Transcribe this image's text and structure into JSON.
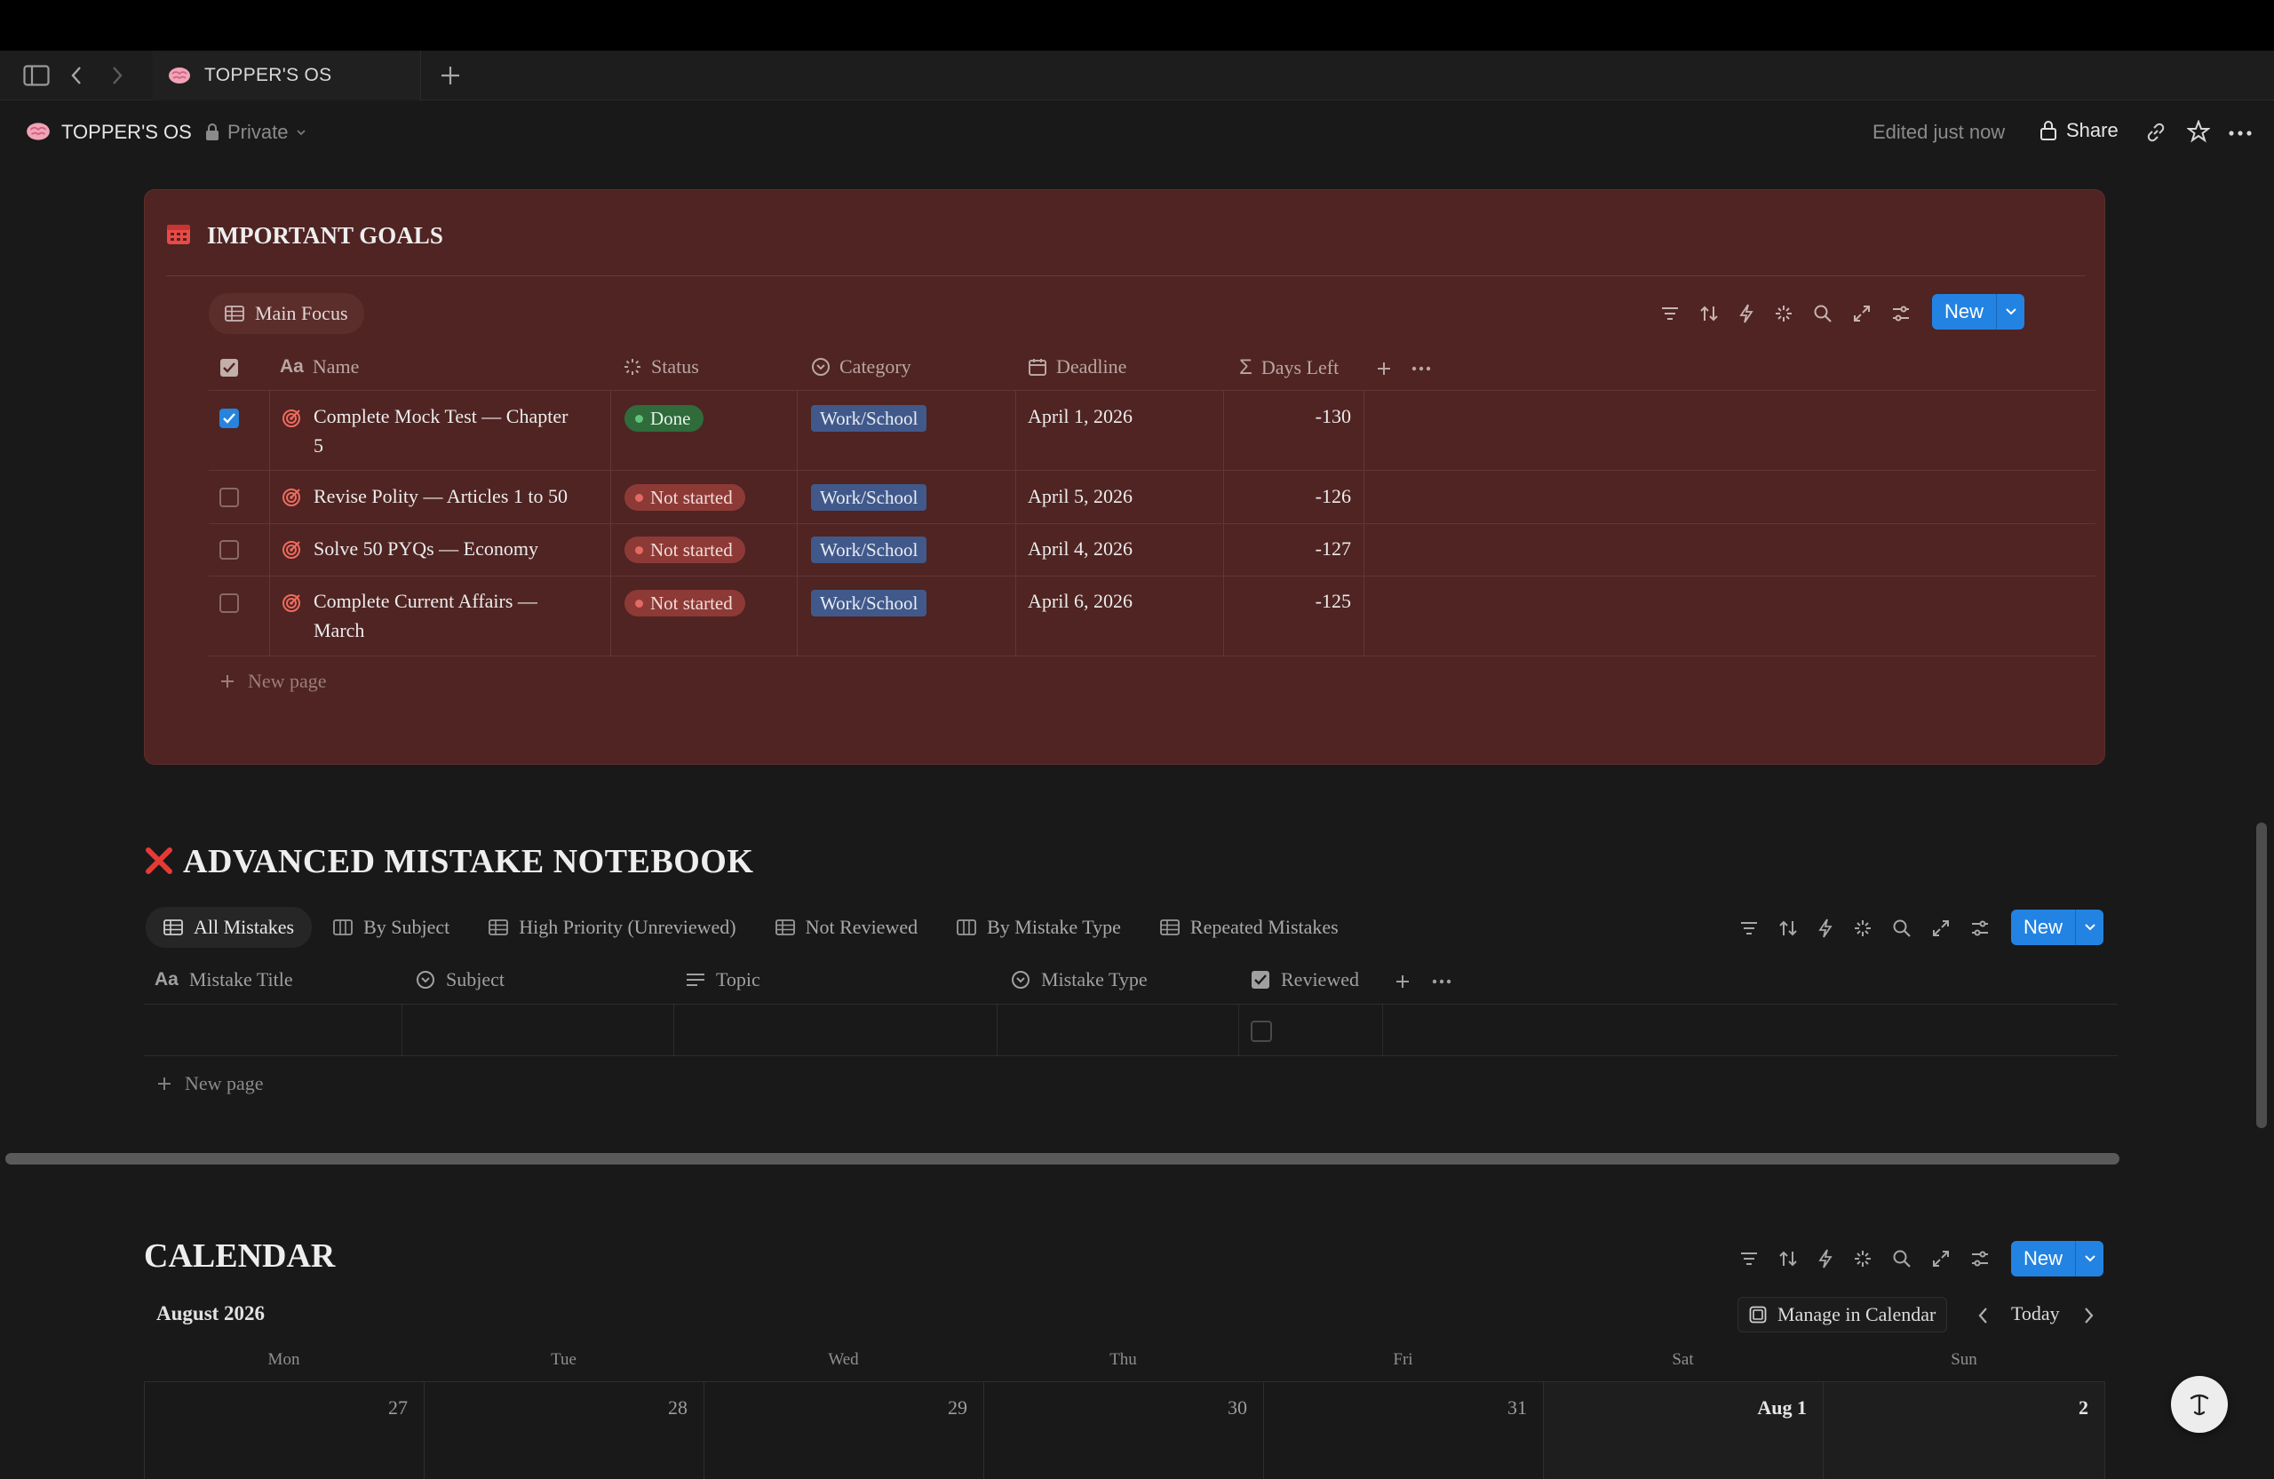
{
  "tabbar": {
    "tab_title": "TOPPER'S OS",
    "colors": {
      "bg": "#1d1d1d"
    }
  },
  "breadcrumb": {
    "title": "TOPPER'S OS",
    "privacy": "Private",
    "edited": "Edited just now",
    "share": "Share"
  },
  "goals": {
    "title": "IMPORTANT GOALS",
    "view_tab": "Main Focus",
    "new_label": "New",
    "columns": {
      "name": "Name",
      "status": "Status",
      "category": "Category",
      "deadline": "Deadline",
      "days_left": "Days Left"
    },
    "rows": [
      {
        "checked": true,
        "name_line1": "Complete Mock Test — Chapter",
        "name_line2": "5",
        "status": "Done",
        "category": "Work/School",
        "deadline": "April 1, 2026",
        "days_left": "-130"
      },
      {
        "checked": false,
        "name_line1": "Revise Polity — Articles 1 to 50",
        "name_line2": "",
        "status": "Not started",
        "category": "Work/School",
        "deadline": "April 5, 2026",
        "days_left": "-126"
      },
      {
        "checked": false,
        "name_line1": "Solve 50 PYQs — Economy",
        "name_line2": "",
        "status": "Not started",
        "category": "Work/School",
        "deadline": "April 4, 2026",
        "days_left": "-127"
      },
      {
        "checked": false,
        "name_line1": "Complete Current Affairs —",
        "name_line2": "March",
        "status": "Not started",
        "category": "Work/School",
        "deadline": "April 6, 2026",
        "days_left": "-125"
      }
    ],
    "new_page": "New page",
    "colors": {
      "panel": "#4f2422",
      "done_pill": "#2f6b3b",
      "not_started_pill": "#8d3a36",
      "category_pill": "#41598a"
    }
  },
  "mistakes": {
    "title": "ADVANCED MISTAKE NOTEBOOK",
    "tabs": [
      "All Mistakes",
      "By Subject",
      "High Priority (Unreviewed)",
      "Not Reviewed",
      "By Mistake Type",
      "Repeated Mistakes"
    ],
    "new_label": "New",
    "columns": {
      "title": "Mistake Title",
      "subject": "Subject",
      "topic": "Topic",
      "type": "Mistake Type",
      "reviewed": "Reviewed"
    },
    "new_page": "New page"
  },
  "calendar": {
    "title": "CALENDAR",
    "month": "August 2026",
    "manage": "Manage in Calendar",
    "today": "Today",
    "new_label": "New",
    "days": [
      "Mon",
      "Tue",
      "Wed",
      "Thu",
      "Fri",
      "Sat",
      "Sun"
    ],
    "dates": [
      "27",
      "28",
      "29",
      "30",
      "31",
      "Aug 1",
      "2"
    ]
  }
}
